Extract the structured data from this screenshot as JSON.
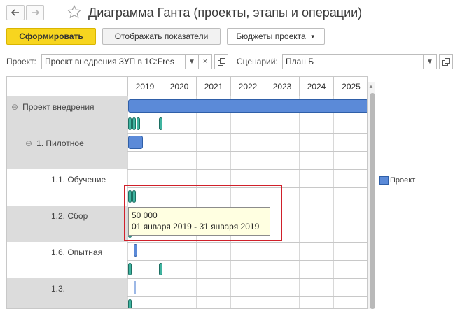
{
  "window": {
    "title": "Диаграмма Ганта (проекты, этапы и операции)",
    "back_icon": "left-arrow",
    "forward_icon": "right-arrow",
    "favorite_icon": "star-outline"
  },
  "toolbar": {
    "generate_label": "Сформировать",
    "show_indicators_label": "Отображать показатели",
    "project_budgets_label": "Бюджеты проекта"
  },
  "filters": {
    "project_label": "Проект:",
    "project_value": "Проект внедрения ЗУП в 1С:Fres",
    "scenario_label": "Сценарий:",
    "scenario_value": "План Б"
  },
  "gantt": {
    "years": [
      "2019",
      "2020",
      "2021",
      "2022",
      "2023",
      "2024",
      "2025"
    ],
    "rows": [
      {
        "label": "Проект внедрения",
        "collapse_icon": "⊖"
      },
      {
        "label": "1. Пилотное",
        "collapse_icon": "⊖"
      },
      {
        "label": "1.1. Обучение"
      },
      {
        "label": "1.2. Сбор"
      },
      {
        "label": "1.6. Опытная"
      },
      {
        "label": "1.3."
      }
    ]
  },
  "legend": {
    "items": [
      {
        "label": "Проект",
        "color": "#5b8ad8"
      }
    ]
  },
  "tooltip": {
    "value": "50 000",
    "period": "01 января 2019 - 31 января 2019"
  },
  "colors": {
    "accent": "#f7d51f",
    "bar_blue": "#5b8ad8",
    "bar_teal": "#3fb4a0",
    "highlight": "#d0202a"
  }
}
